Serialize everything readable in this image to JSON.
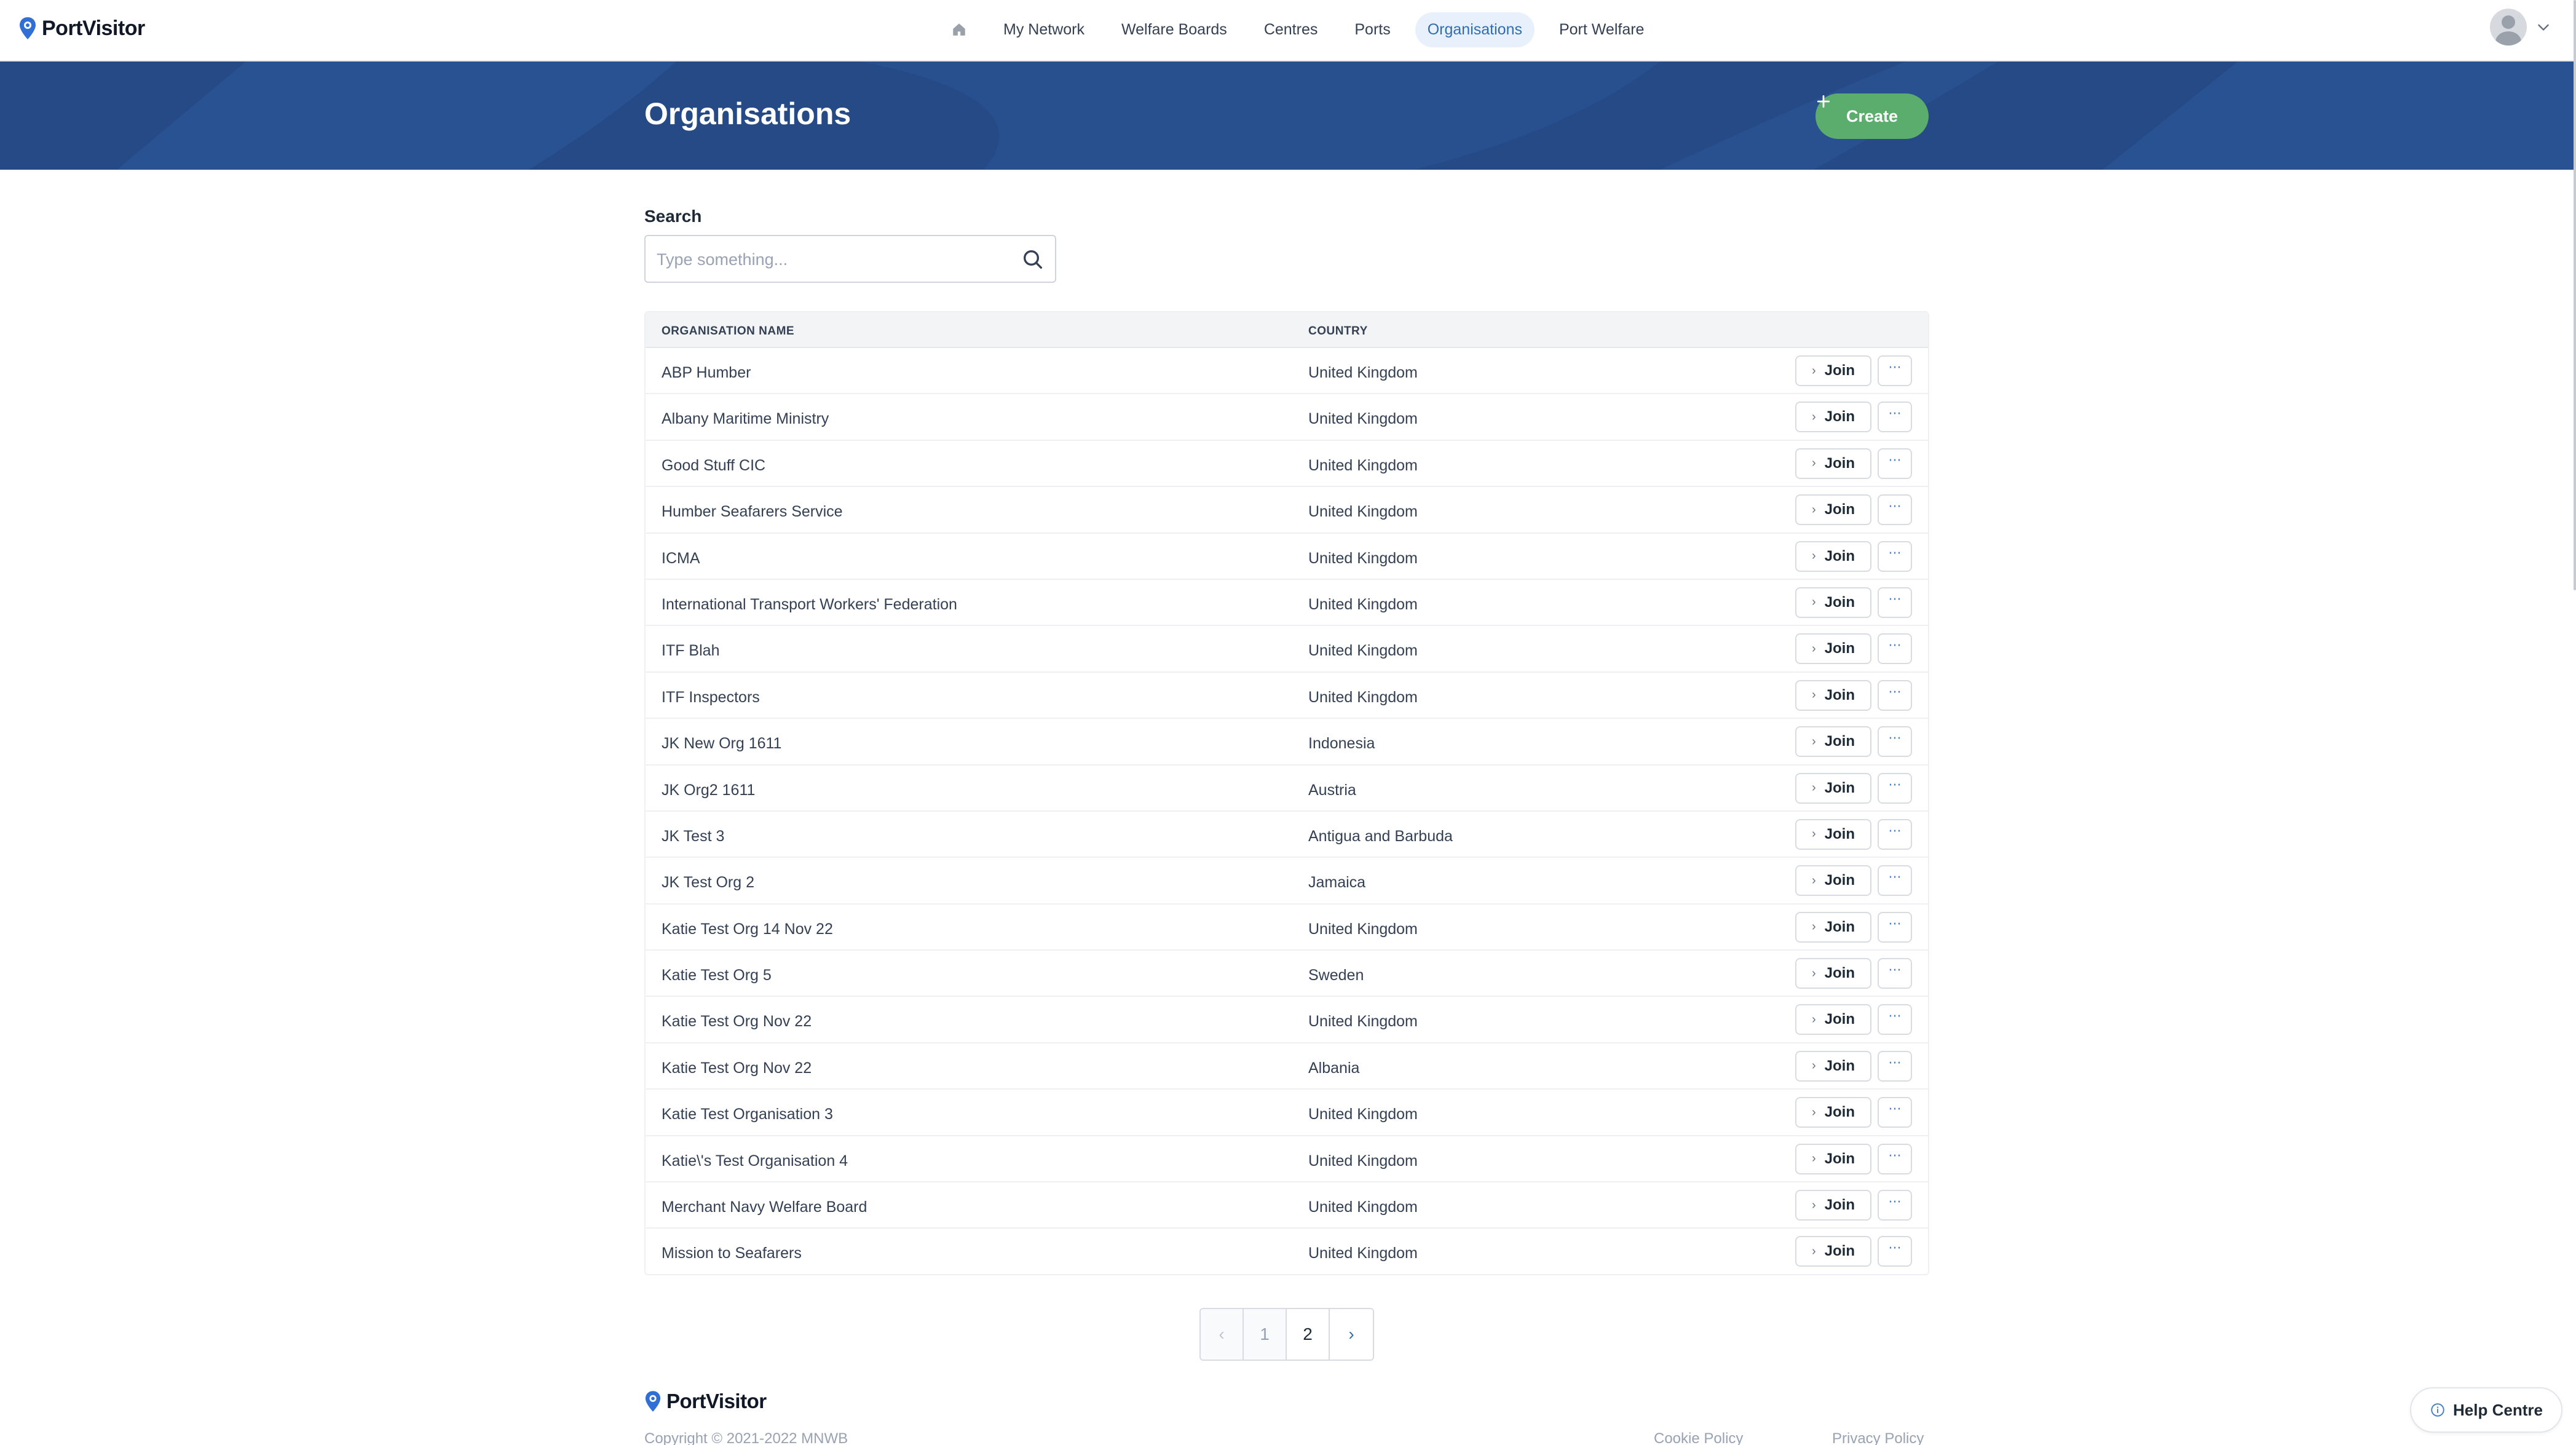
{
  "brand": {
    "name": "PortVisitor",
    "icon": "location-pin-icon"
  },
  "nav": {
    "home_icon": "home-icon",
    "items": [
      {
        "label": "My Network",
        "active": false
      },
      {
        "label": "Welfare Boards",
        "active": false
      },
      {
        "label": "Centres",
        "active": false
      },
      {
        "label": "Ports",
        "active": false
      },
      {
        "label": "Organisations",
        "active": true
      },
      {
        "label": "Port Welfare",
        "active": false
      }
    ],
    "user_menu_icon": "chevron-down-icon"
  },
  "header": {
    "title": "Organisations",
    "create_label": "Create",
    "create_icon": "plus-icon"
  },
  "search": {
    "label": "Search",
    "placeholder": "Type something...",
    "value": "",
    "icon": "search-icon"
  },
  "table": {
    "columns": [
      "ORGANISATION NAME",
      "COUNTRY"
    ],
    "join_label": "Join",
    "more_label": "···",
    "rows": [
      {
        "name": "ABP Humber",
        "country": "United Kingdom"
      },
      {
        "name": "Albany Maritime Ministry",
        "country": "United Kingdom"
      },
      {
        "name": "Good Stuff CIC",
        "country": "United Kingdom"
      },
      {
        "name": "Humber Seafarers Service",
        "country": "United Kingdom"
      },
      {
        "name": "ICMA",
        "country": "United Kingdom"
      },
      {
        "name": "International Transport Workers' Federation",
        "country": "United Kingdom"
      },
      {
        "name": "ITF Blah",
        "country": "United Kingdom"
      },
      {
        "name": "ITF Inspectors",
        "country": "United Kingdom"
      },
      {
        "name": "JK New Org 1611",
        "country": "Indonesia"
      },
      {
        "name": "JK Org2 1611",
        "country": "Austria"
      },
      {
        "name": "JK Test 3",
        "country": "Antigua and Barbuda"
      },
      {
        "name": "JK Test Org 2",
        "country": "Jamaica"
      },
      {
        "name": "Katie Test Org 14 Nov 22",
        "country": "United Kingdom"
      },
      {
        "name": "Katie Test Org 5",
        "country": "Sweden"
      },
      {
        "name": "Katie Test Org Nov 22",
        "country": "United Kingdom"
      },
      {
        "name": "Katie Test Org Nov 22",
        "country": "Albania"
      },
      {
        "name": "Katie Test Organisation 3",
        "country": "United Kingdom"
      },
      {
        "name": "Katie\\'s Test Organisation 4",
        "country": "United Kingdom"
      },
      {
        "name": "Merchant Navy Welfare Board",
        "country": "United Kingdom"
      },
      {
        "name": "Mission to Seafarers",
        "country": "United Kingdom"
      }
    ]
  },
  "pagination": {
    "prev": "‹",
    "pages": [
      "1",
      "2"
    ],
    "current": "2",
    "next": "›"
  },
  "footer": {
    "copyright": "Copyright © 2021-2022 MNWB",
    "links": [
      "Cookie Policy",
      "Privacy Policy"
    ]
  },
  "help": {
    "label": "Help Centre",
    "icon": "info-circle-icon"
  },
  "colors": {
    "header_band": "#254a86",
    "create_button": "#5bad6e",
    "accent": "#2e6db4"
  }
}
